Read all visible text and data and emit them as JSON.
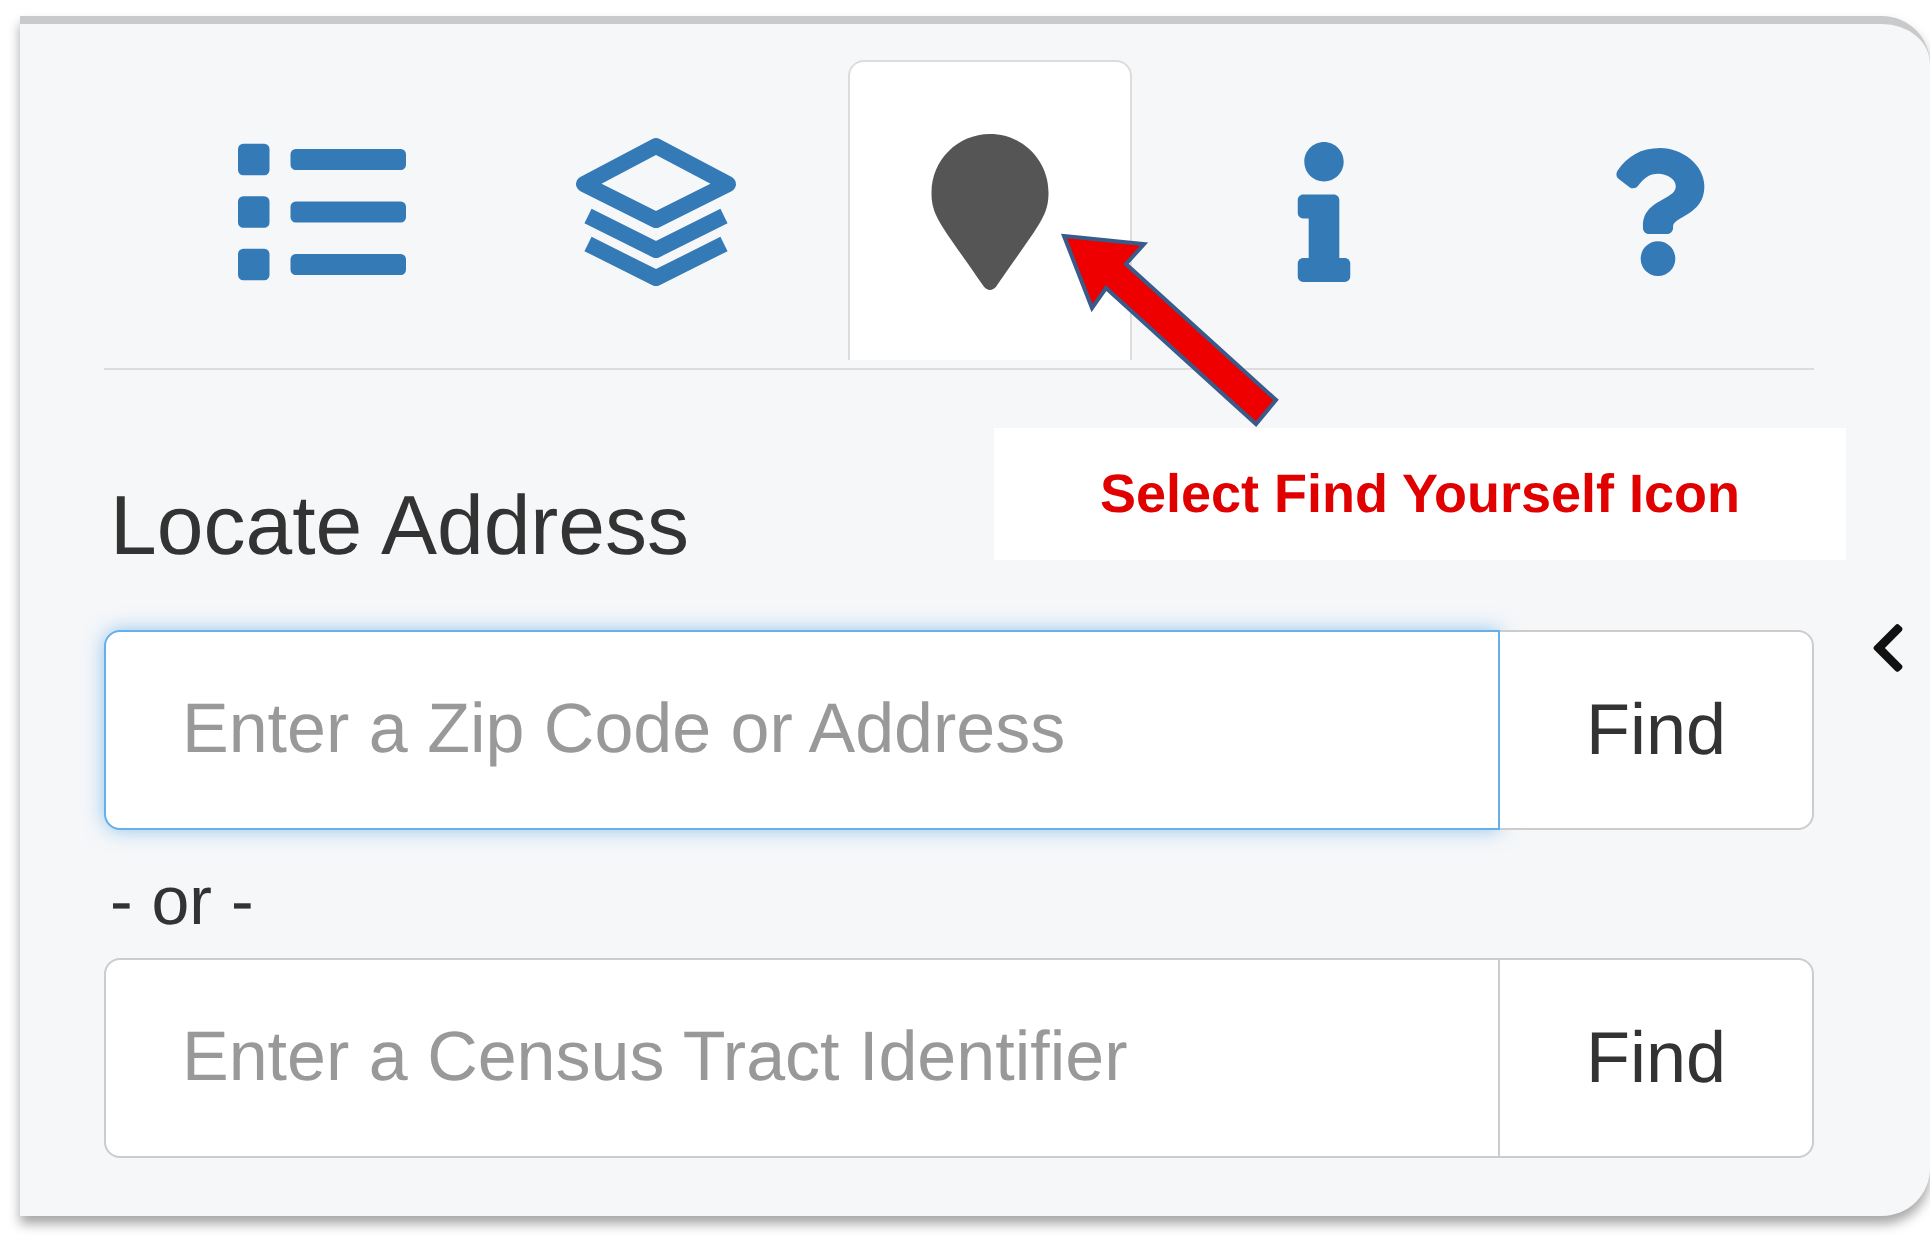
{
  "tabs": [
    {
      "kind": "list",
      "selected": false
    },
    {
      "kind": "layers",
      "selected": false
    },
    {
      "kind": "pin",
      "selected": true
    },
    {
      "kind": "info",
      "selected": false
    },
    {
      "kind": "help",
      "selected": false
    }
  ],
  "heading": "Locate Address",
  "callout": "Select Find Yourself Icon",
  "search_forms": [
    {
      "placeholder": "Enter a Zip Code or Address",
      "focused": true,
      "button": "Find"
    },
    {
      "placeholder": "Enter a Census Tract Identifier",
      "focused": false,
      "button": "Find"
    }
  ],
  "separator": "- or -"
}
